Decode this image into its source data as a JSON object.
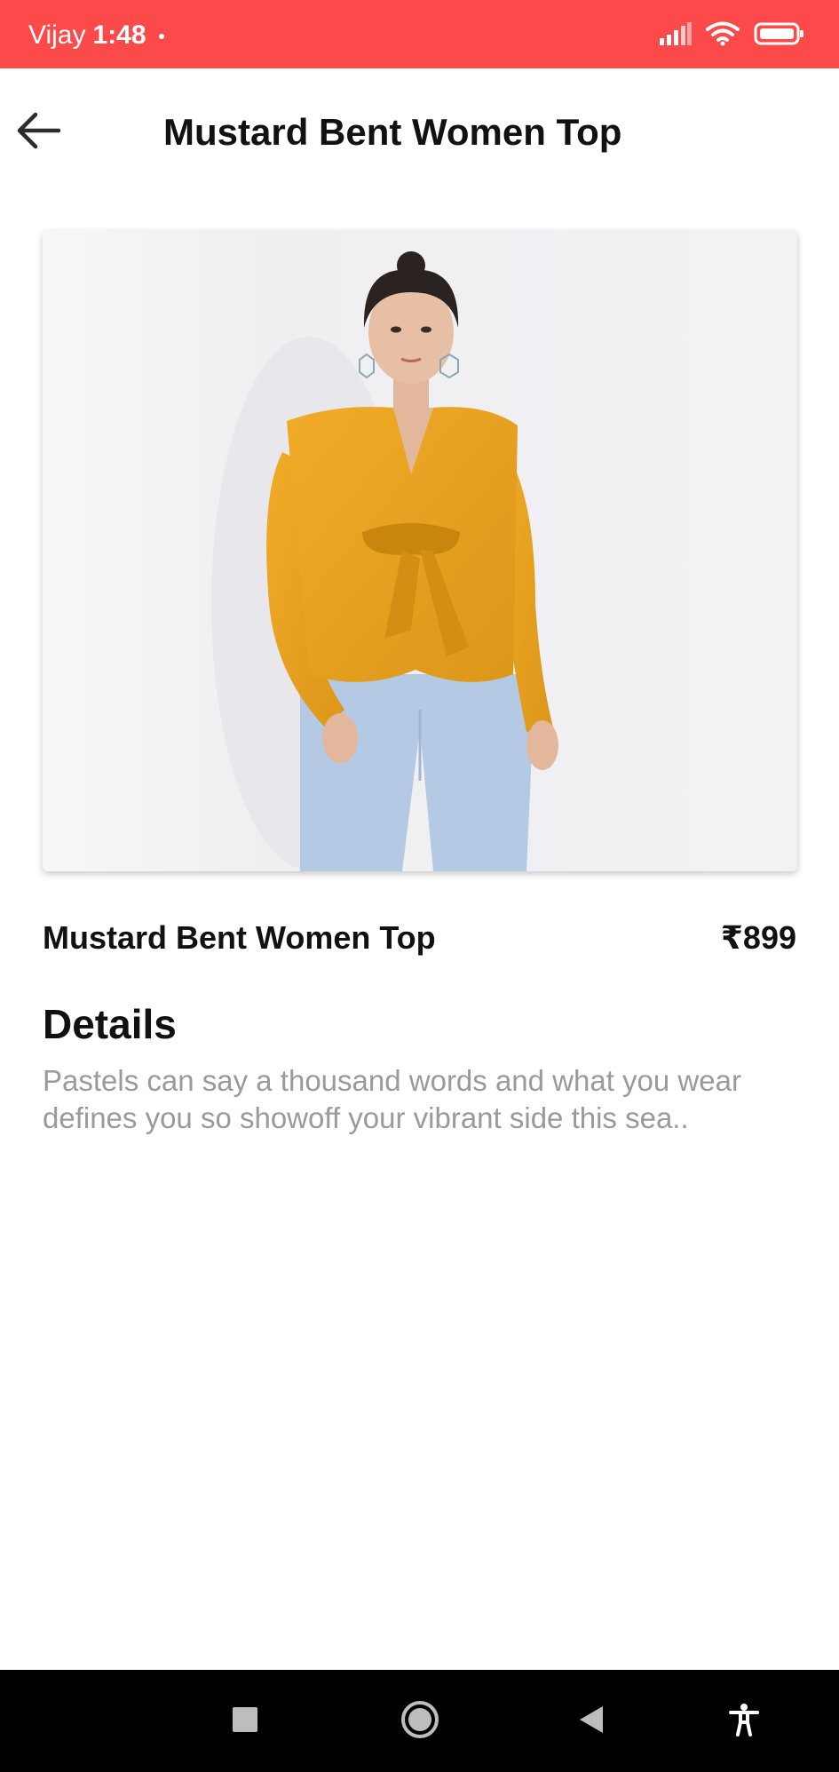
{
  "status_bar": {
    "carrier": "Vijay",
    "time": "1:48",
    "background": "#fc4a4a",
    "icons": [
      "signal-icon",
      "wifi-icon",
      "battery-icon"
    ]
  },
  "app_bar": {
    "title": "Mustard Bent Women Top",
    "back_icon": "arrow-left-icon"
  },
  "product": {
    "name": "Mustard Bent Women Top",
    "price": "₹899",
    "image_label": "product-photo"
  },
  "details": {
    "heading": "Details",
    "description": "Pastels can say a thousand words and what you wear defines you so showoff your vibrant side this sea.."
  },
  "nav_bar": {
    "buttons": [
      "recents-icon",
      "home-icon",
      "back-triangle-icon",
      "accessibility-icon"
    ]
  },
  "colors": {
    "accent": "#fc4a4a",
    "mustard": "#e9a21f",
    "denim": "#b4c9e4",
    "description_text": "#9a9a9a"
  }
}
